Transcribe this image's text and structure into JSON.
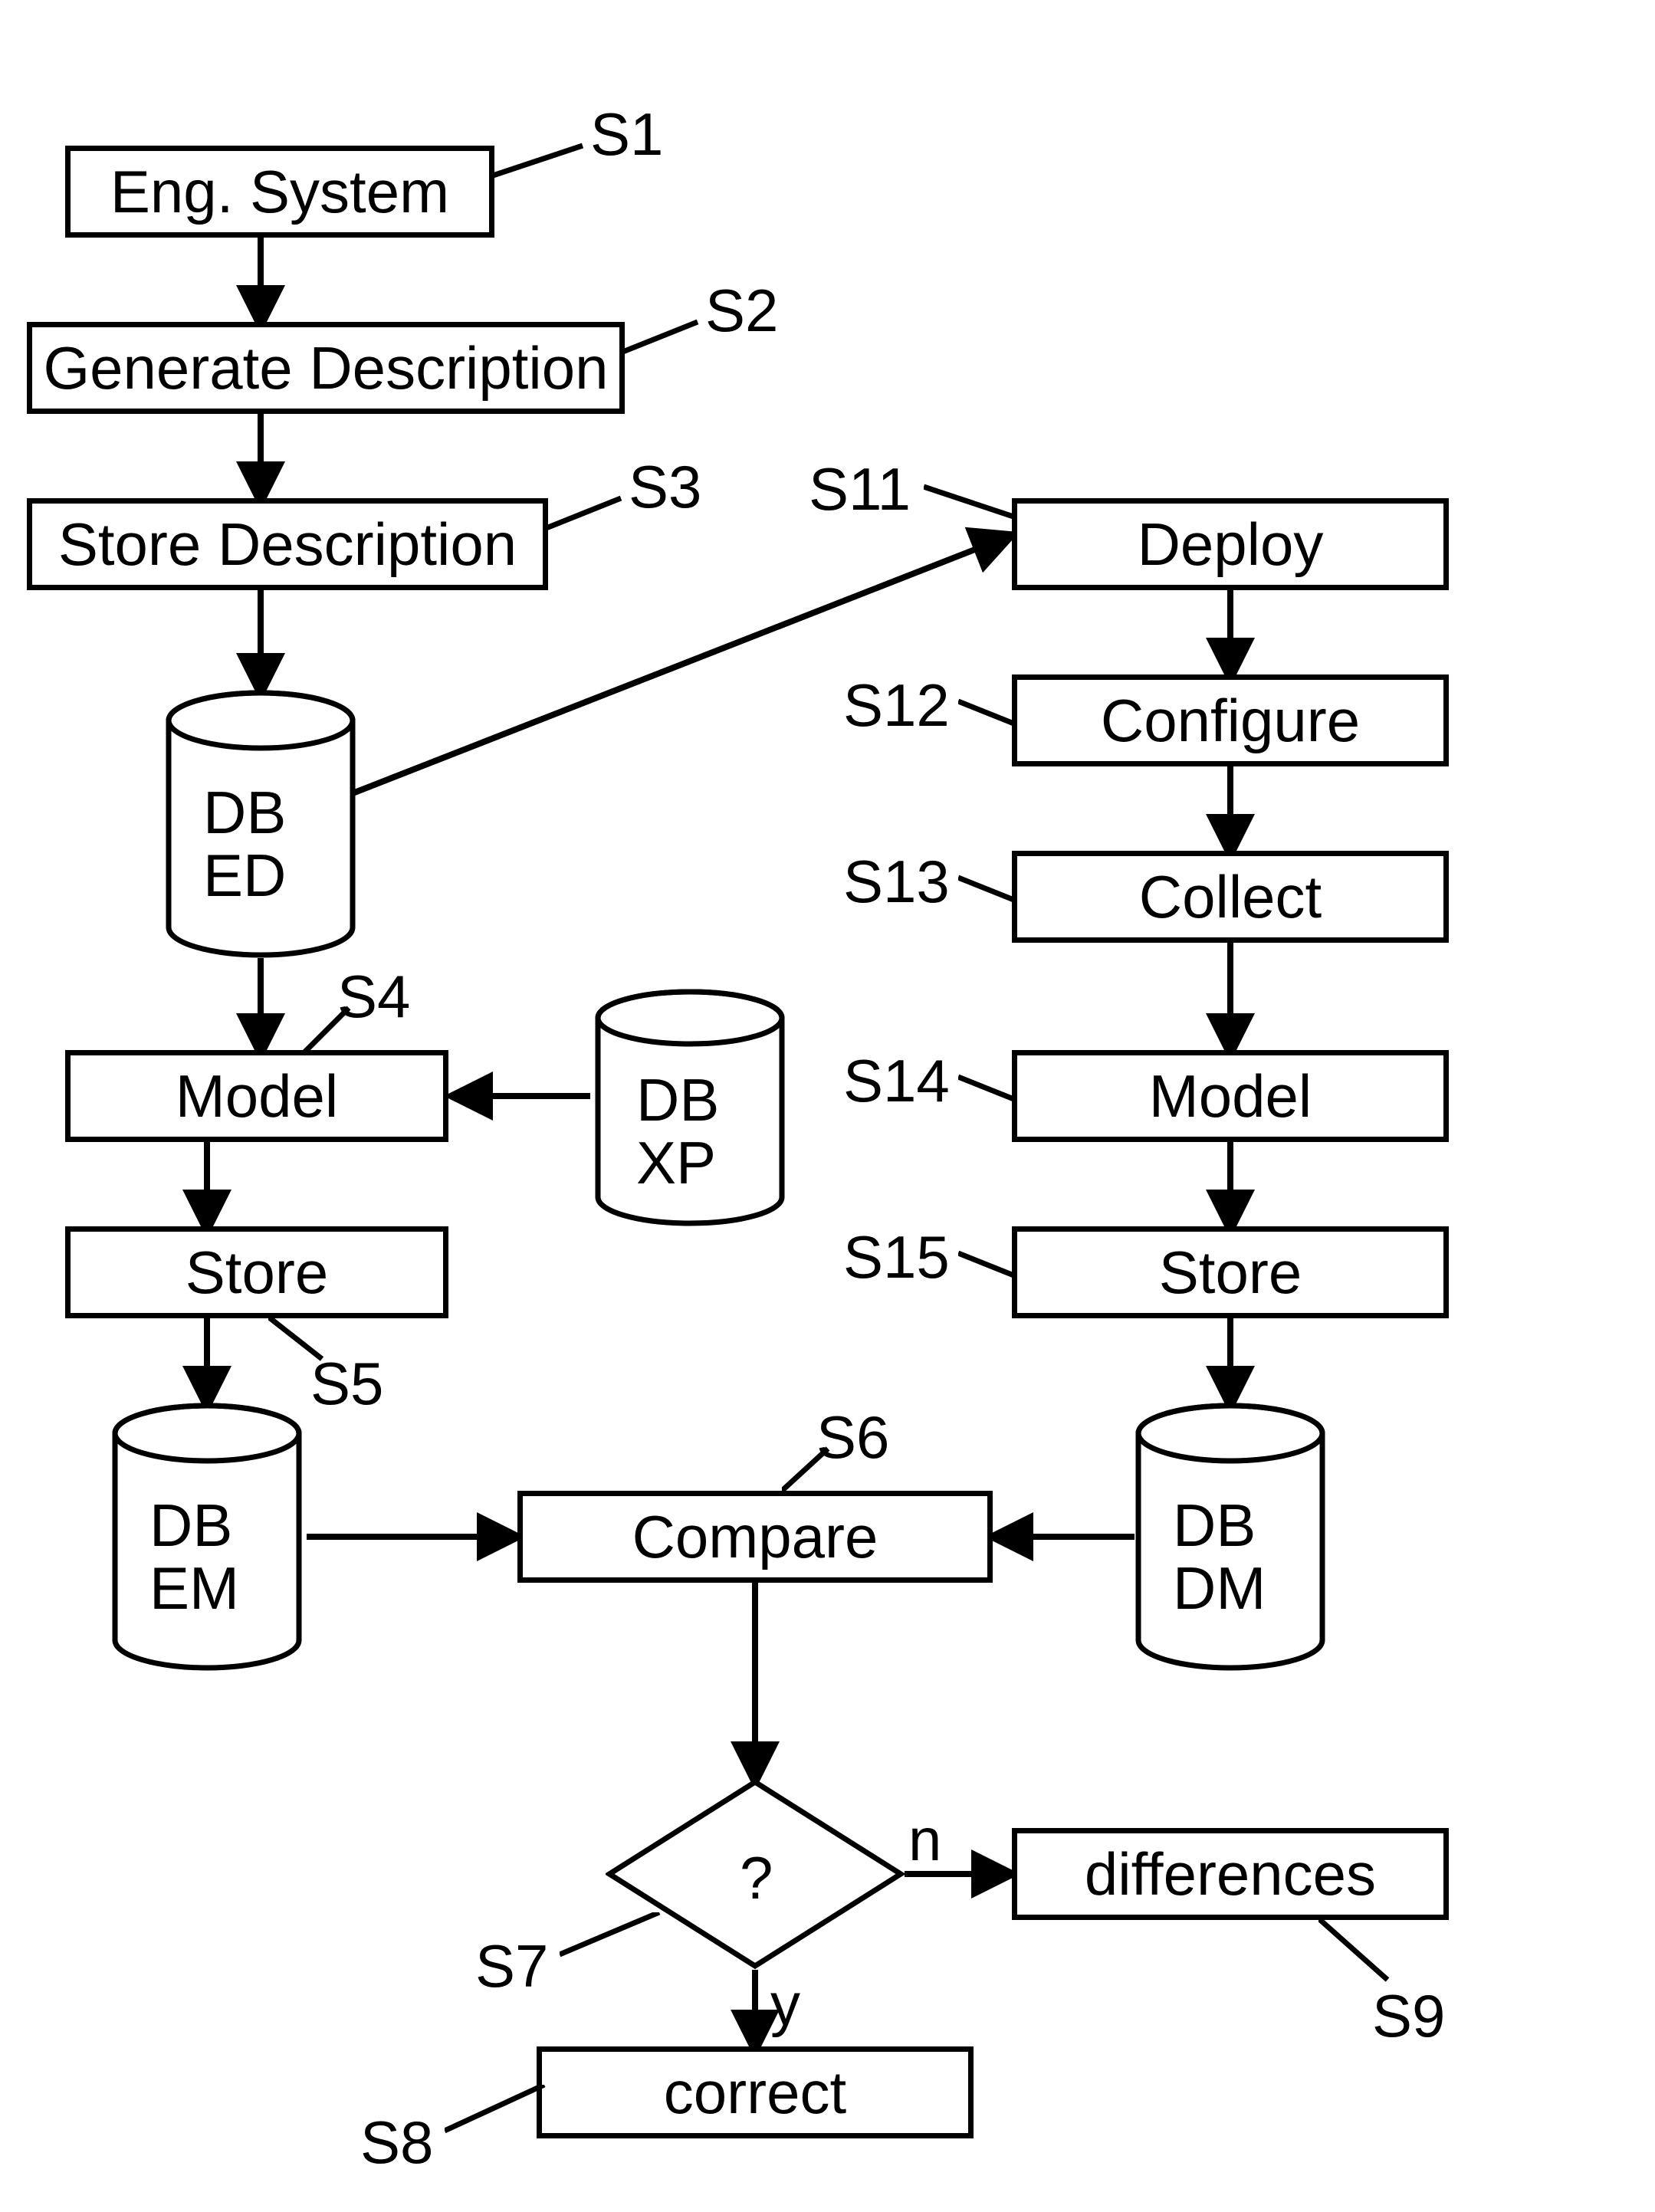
{
  "boxes": {
    "s1": "Eng. System",
    "s2": "Generate Description",
    "s3": "Store Description",
    "s4": "Model",
    "s5": "Store",
    "s6": "Compare",
    "s8": "correct",
    "s9": "differences",
    "s11": "Deploy",
    "s12": "Configure",
    "s13": "Collect",
    "s14": "Model",
    "s15": "Store"
  },
  "dbs": {
    "ed_l1": "DB",
    "ed_l2": "ED",
    "xp_l1": "DB",
    "xp_l2": "XP",
    "em_l1": "DB",
    "em_l2": "EM",
    "dm_l1": "DB",
    "dm_l2": "DM"
  },
  "decision": {
    "q": "?",
    "yes": "y",
    "no": "n"
  },
  "step_labels": {
    "s1": "S1",
    "s2": "S2",
    "s3": "S3",
    "s4": "S4",
    "s5": "S5",
    "s6": "S6",
    "s7": "S7",
    "s8": "S8",
    "s9": "S9",
    "s11": "S11",
    "s12": "S12",
    "s13": "S13",
    "s14": "S14",
    "s15": "S15"
  },
  "chart_data": {
    "type": "flowchart",
    "nodes": [
      {
        "id": "S1",
        "kind": "process",
        "label": "Eng. System"
      },
      {
        "id": "S2",
        "kind": "process",
        "label": "Generate Description"
      },
      {
        "id": "S3",
        "kind": "process",
        "label": "Store Description"
      },
      {
        "id": "DB_ED",
        "kind": "datastore",
        "label": "DB ED"
      },
      {
        "id": "S4",
        "kind": "process",
        "label": "Model"
      },
      {
        "id": "DB_XP",
        "kind": "datastore",
        "label": "DB XP"
      },
      {
        "id": "S5",
        "kind": "process",
        "label": "Store"
      },
      {
        "id": "DB_EM",
        "kind": "datastore",
        "label": "DB EM"
      },
      {
        "id": "S6",
        "kind": "process",
        "label": "Compare"
      },
      {
        "id": "S7",
        "kind": "decision",
        "label": "?"
      },
      {
        "id": "S8",
        "kind": "process",
        "label": "correct"
      },
      {
        "id": "S9",
        "kind": "process",
        "label": "differences"
      },
      {
        "id": "S11",
        "kind": "process",
        "label": "Deploy"
      },
      {
        "id": "S12",
        "kind": "process",
        "label": "Configure"
      },
      {
        "id": "S13",
        "kind": "process",
        "label": "Collect"
      },
      {
        "id": "S14",
        "kind": "process",
        "label": "Model"
      },
      {
        "id": "S15",
        "kind": "process",
        "label": "Store"
      },
      {
        "id": "DB_DM",
        "kind": "datastore",
        "label": "DB DM"
      }
    ],
    "edges": [
      {
        "from": "S1",
        "to": "S2"
      },
      {
        "from": "S2",
        "to": "S3"
      },
      {
        "from": "S3",
        "to": "DB_ED"
      },
      {
        "from": "DB_ED",
        "to": "S4"
      },
      {
        "from": "DB_ED",
        "to": "S11"
      },
      {
        "from": "DB_XP",
        "to": "S4"
      },
      {
        "from": "S4",
        "to": "S5"
      },
      {
        "from": "S5",
        "to": "DB_EM"
      },
      {
        "from": "DB_EM",
        "to": "S6"
      },
      {
        "from": "S11",
        "to": "S12"
      },
      {
        "from": "S12",
        "to": "S13"
      },
      {
        "from": "S13",
        "to": "S14"
      },
      {
        "from": "S14",
        "to": "S15"
      },
      {
        "from": "S15",
        "to": "DB_DM"
      },
      {
        "from": "DB_DM",
        "to": "S6"
      },
      {
        "from": "S6",
        "to": "S7"
      },
      {
        "from": "S7",
        "to": "S8",
        "label": "y"
      },
      {
        "from": "S7",
        "to": "S9",
        "label": "n"
      }
    ]
  }
}
